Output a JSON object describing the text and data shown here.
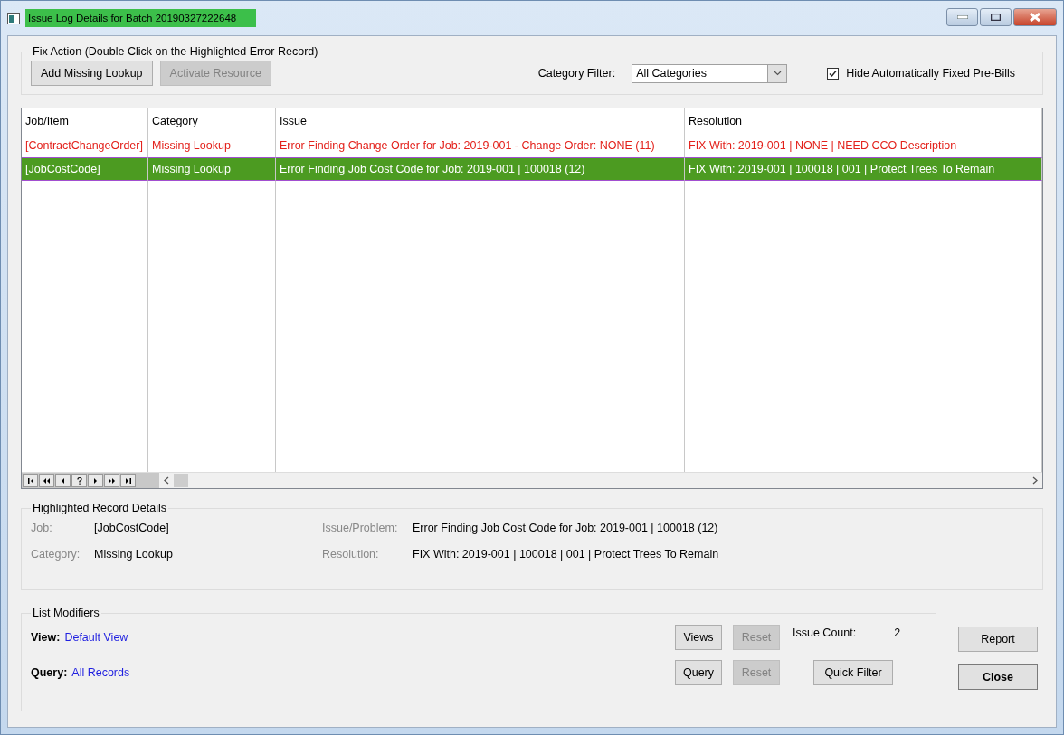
{
  "window": {
    "title": "Issue Log Details for Batch 20190327222648"
  },
  "fix_action": {
    "legend": "Fix Action (Double Click on the Highlighted Error Record)",
    "buttons": [
      {
        "label": "Add Missing Lookup",
        "disabled": false
      },
      {
        "label": "Activate Resource",
        "disabled": true
      }
    ],
    "category_filter": {
      "label": "Category Filter:",
      "value": "All Categories"
    },
    "hide_fixed": {
      "label": "Hide Automatically Fixed Pre-Bills",
      "checked": true
    }
  },
  "table": {
    "columns": [
      "Job/Item",
      "Category",
      "Issue",
      "Resolution"
    ],
    "rows": [
      {
        "cells": [
          "[ContractChangeOrder]",
          "Missing Lookup",
          "Error Finding Change Order for Job: 2019-001   - Change Order: NONE (11)",
          "FIX With: 2019-001 | NONE | NEED CCO Description"
        ],
        "error": true,
        "selected": false
      },
      {
        "cells": [
          "[JobCostCode]",
          "Missing Lookup",
          "Error Finding Job Cost Code for Job: 2019-001 | 100018 (12)",
          "FIX With: 2019-001 | 100018 | 001 | Protect Trees To Remain"
        ],
        "error": false,
        "selected": true
      }
    ]
  },
  "details": {
    "legend": "Highlighted Record Details",
    "fields": [
      {
        "label": "Job:",
        "value": "[JobCostCode]"
      },
      {
        "label": "Issue/Problem:",
        "value": "Error Finding Job Cost Code for Job: 2019-001 | 100018 (12)"
      },
      {
        "label": "Category:",
        "value": "Missing Lookup"
      },
      {
        "label": "Resolution:",
        "value": "FIX With: 2019-001 | 100018 | 001 | Protect Trees To Remain"
      }
    ]
  },
  "list_modifiers": {
    "legend": "List Modifiers",
    "view": {
      "label": "View:",
      "value": "Default View"
    },
    "query": {
      "label": "Query:",
      "value": "All Records"
    },
    "views_button": {
      "label": "Views",
      "disabled": false
    },
    "view_reset": {
      "label": "Reset",
      "disabled": true
    },
    "query_button": {
      "label": "Query",
      "disabled": false
    },
    "query_reset": {
      "label": "Reset",
      "disabled": true
    },
    "issue_count": {
      "label": "Issue Count:",
      "value": "2"
    },
    "quick_filter": {
      "label": "Quick Filter",
      "disabled": false
    }
  },
  "side_buttons": [
    {
      "label": "Report",
      "default": false
    },
    {
      "label": "Close",
      "default": true
    }
  ]
}
